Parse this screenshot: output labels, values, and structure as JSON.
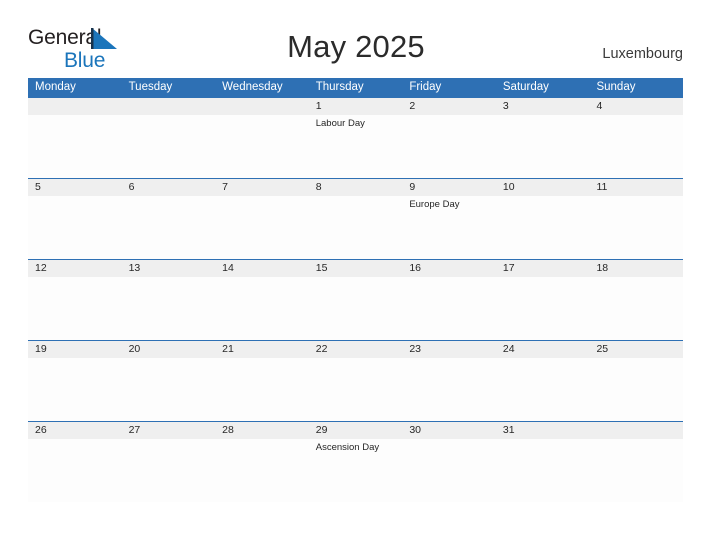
{
  "branding": {
    "logo_word1": "General",
    "logo_word2": "Blue",
    "logo_icon": "blue-triangle-flag-icon",
    "accent_color": "#1b75bb"
  },
  "header": {
    "title": "May 2025",
    "location": "Luxembourg",
    "header_bar_color": "#2e70b4",
    "date_strip_color": "#efefef"
  },
  "calendar": {
    "day_names": [
      "Monday",
      "Tuesday",
      "Wednesday",
      "Thursday",
      "Friday",
      "Saturday",
      "Sunday"
    ],
    "weeks": [
      {
        "days": [
          {
            "date": "",
            "event": ""
          },
          {
            "date": "",
            "event": ""
          },
          {
            "date": "",
            "event": ""
          },
          {
            "date": "1",
            "event": "Labour Day"
          },
          {
            "date": "2",
            "event": ""
          },
          {
            "date": "3",
            "event": ""
          },
          {
            "date": "4",
            "event": ""
          }
        ]
      },
      {
        "days": [
          {
            "date": "5",
            "event": ""
          },
          {
            "date": "6",
            "event": ""
          },
          {
            "date": "7",
            "event": ""
          },
          {
            "date": "8",
            "event": ""
          },
          {
            "date": "9",
            "event": "Europe Day"
          },
          {
            "date": "10",
            "event": ""
          },
          {
            "date": "11",
            "event": ""
          }
        ]
      },
      {
        "days": [
          {
            "date": "12",
            "event": ""
          },
          {
            "date": "13",
            "event": ""
          },
          {
            "date": "14",
            "event": ""
          },
          {
            "date": "15",
            "event": ""
          },
          {
            "date": "16",
            "event": ""
          },
          {
            "date": "17",
            "event": ""
          },
          {
            "date": "18",
            "event": ""
          }
        ]
      },
      {
        "days": [
          {
            "date": "19",
            "event": ""
          },
          {
            "date": "20",
            "event": ""
          },
          {
            "date": "21",
            "event": ""
          },
          {
            "date": "22",
            "event": ""
          },
          {
            "date": "23",
            "event": ""
          },
          {
            "date": "24",
            "event": ""
          },
          {
            "date": "25",
            "event": ""
          }
        ]
      },
      {
        "days": [
          {
            "date": "26",
            "event": ""
          },
          {
            "date": "27",
            "event": ""
          },
          {
            "date": "28",
            "event": ""
          },
          {
            "date": "29",
            "event": "Ascension Day"
          },
          {
            "date": "30",
            "event": ""
          },
          {
            "date": "31",
            "event": ""
          },
          {
            "date": "",
            "event": ""
          }
        ]
      }
    ]
  }
}
